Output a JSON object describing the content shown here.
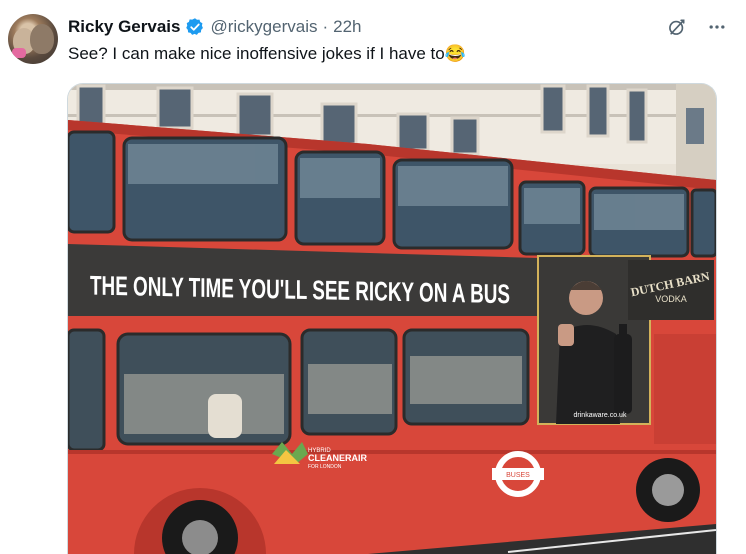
{
  "tweet": {
    "author_name": "Ricky Gervais",
    "handle": "@rickygervais",
    "separator": "·",
    "time": "22h",
    "text": "See? I can make nice inoffensive jokes if I have to😂",
    "verified": true
  },
  "icons": {
    "verified": "verified-badge-icon",
    "grok": "grok-icon",
    "more": "more-icon"
  },
  "media": {
    "banner_text": "THE ONLY TIME YOU'LL SEE RICKY ON A BUS",
    "brand_line1": "DUTCH BARN",
    "brand_line2": "VODKA",
    "brand_url": "drinkaware.co.uk",
    "cleanair_line1": "HYBRID",
    "cleanair_line2": "CLEANERAIR",
    "cleanair_line3": "FOR LONDON",
    "roundel": "BUSES"
  },
  "colors": {
    "accent": "#1d9bf0",
    "bus_red": "#d8473a",
    "banner": "#3b3a39",
    "text_secondary": "#536471"
  }
}
